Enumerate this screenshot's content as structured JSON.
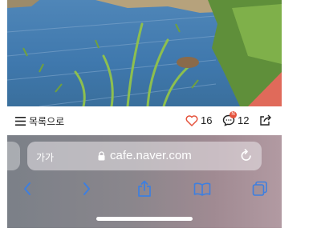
{
  "actionbar": {
    "list_label": "목록으로",
    "likes": "16",
    "comments": "12",
    "comment_badge": "N",
    "accent_red": "#e5533d"
  },
  "browser": {
    "text_size_label": "가가",
    "url": "cafe.naver.com"
  },
  "icons": [
    "list-icon",
    "heart-icon",
    "comment-icon",
    "share-icon",
    "lock-icon",
    "reload-icon",
    "back-icon",
    "forward-icon",
    "share-sheet-icon",
    "bookmarks-icon",
    "tabs-icon"
  ]
}
